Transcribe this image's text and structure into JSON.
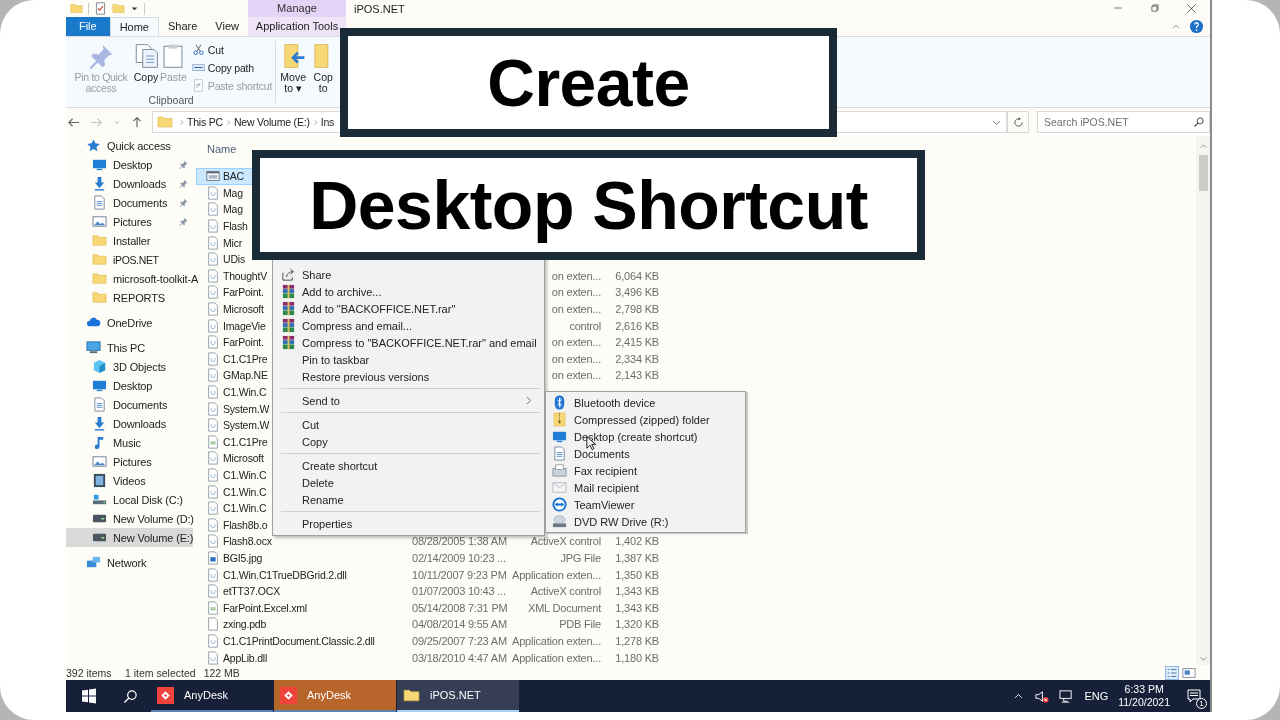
{
  "window": {
    "title": "iPOS.NET"
  },
  "ribbon": {
    "context_tab_group": "Manage",
    "tabs": [
      {
        "label": "File",
        "kind": "file",
        "selected": false
      },
      {
        "label": "Home",
        "kind": "normal",
        "selected": true
      },
      {
        "label": "Share",
        "kind": "normal",
        "selected": false
      },
      {
        "label": "View",
        "kind": "normal",
        "selected": false
      },
      {
        "label": "Application Tools",
        "kind": "context",
        "selected": false
      }
    ],
    "clipboard": {
      "label": "Clipboard",
      "large": [
        {
          "label": "Pin to Quick access",
          "kind": "pin",
          "disabled": true
        },
        {
          "label": "Copy",
          "kind": "copy",
          "disabled": false
        },
        {
          "label": "Paste",
          "kind": "paste",
          "disabled": true
        }
      ],
      "small": [
        {
          "label": "Cut",
          "kind": "cut",
          "disabled": false
        },
        {
          "label": "Copy path",
          "kind": "copypath",
          "disabled": false
        },
        {
          "label": "Paste shortcut",
          "kind": "pasteshortcut",
          "disabled": true
        }
      ]
    },
    "organize": [
      {
        "lines": [
          "Move",
          "to ▾"
        ],
        "kind": "move"
      },
      {
        "lines": [
          "Cop",
          "to"
        ],
        "kind": "copyto"
      }
    ]
  },
  "address": {
    "breadcrumbs": [
      "This PC",
      "New Volume (E:)",
      "Ins"
    ],
    "search_placeholder": "Search iPOS.NET"
  },
  "nav": {
    "items": [
      {
        "label": "Quick access",
        "kind": "star",
        "selected": false,
        "children": [
          {
            "label": "Desktop",
            "kind": "desktop",
            "pinned": true,
            "selected": false
          },
          {
            "label": "Downloads",
            "kind": "downloads",
            "pinned": true,
            "selected": false
          },
          {
            "label": "Documents",
            "kind": "documents",
            "pinned": true,
            "selected": false
          },
          {
            "label": "Pictures",
            "kind": "pictures",
            "pinned": true,
            "selected": false
          },
          {
            "label": "Installer",
            "kind": "folder",
            "pinned": false,
            "selected": false
          },
          {
            "label": "iPOS.NET",
            "kind": "folder",
            "pinned": false,
            "selected": false
          },
          {
            "label": "microsoft-toolkit-A",
            "kind": "folder",
            "pinned": false,
            "selected": false
          },
          {
            "label": "REPORTS",
            "kind": "folder",
            "pinned": false,
            "selected": false
          }
        ]
      },
      {
        "label": "OneDrive",
        "kind": "cloud",
        "selected": false
      },
      {
        "label": "This PC",
        "kind": "pc",
        "selected": false,
        "children": [
          {
            "label": "3D Objects",
            "kind": "cube",
            "selected": false
          },
          {
            "label": "Desktop",
            "kind": "desktop",
            "selected": false
          },
          {
            "label": "Documents",
            "kind": "documents",
            "selected": false
          },
          {
            "label": "Downloads",
            "kind": "downloads",
            "selected": false
          },
          {
            "label": "Music",
            "kind": "music",
            "selected": false
          },
          {
            "label": "Pictures",
            "kind": "pictures",
            "selected": false
          },
          {
            "label": "Videos",
            "kind": "video",
            "selected": false
          },
          {
            "label": "Local Disk (C:)",
            "kind": "sysdisk",
            "selected": false
          },
          {
            "label": "New Volume (D:)",
            "kind": "drive",
            "selected": false
          },
          {
            "label": "New Volume (E:)",
            "kind": "drive",
            "selected": true
          }
        ]
      },
      {
        "label": "Network",
        "kind": "network",
        "selected": false
      }
    ]
  },
  "files": {
    "name_header": "Name",
    "rows": [
      {
        "name": "BAC",
        "kind": "program",
        "selected": true
      },
      {
        "name": "Mag",
        "kind": "file",
        "selected": false
      },
      {
        "name": "Mag",
        "kind": "file",
        "selected": false
      },
      {
        "name": "Flash",
        "kind": "file",
        "selected": false
      },
      {
        "name": "Micr",
        "kind": "file",
        "selected": false
      },
      {
        "name": "UDis",
        "kind": "file",
        "selected": false
      },
      {
        "name": "ThoughtV",
        "kind": "file",
        "type": "on exten...",
        "size": "6,064 KB",
        "selected": false
      },
      {
        "name": "FarPoint.",
        "kind": "file",
        "type": "on exten...",
        "size": "3,496 KB",
        "selected": false
      },
      {
        "name": "Microsoft",
        "kind": "file",
        "type": "on exten...",
        "size": "2,798 KB",
        "selected": false
      },
      {
        "name": "ImageVie",
        "kind": "file",
        "type": "control",
        "size": "2,616 KB",
        "selected": false
      },
      {
        "name": "FarPoint.",
        "kind": "file",
        "type": "on exten...",
        "size": "2,415 KB",
        "selected": false
      },
      {
        "name": "C1.C1Pre",
        "kind": "file",
        "type": "on exten...",
        "size": "2,334 KB",
        "selected": false
      },
      {
        "name": "GMap.NE",
        "kind": "file",
        "type": "on exten...",
        "size": "2,143 KB",
        "selected": false
      },
      {
        "name": "C1.Win.C",
        "kind": "file",
        "selected": false
      },
      {
        "name": "System.W",
        "kind": "file",
        "selected": false
      },
      {
        "name": "System.W",
        "kind": "file",
        "selected": false
      },
      {
        "name": "C1.C1Pre",
        "kind": "xml",
        "selected": false
      },
      {
        "name": "Microsoft",
        "kind": "file",
        "selected": false
      },
      {
        "name": "C1.Win.C",
        "kind": "file",
        "selected": false
      },
      {
        "name": "C1.Win.C",
        "kind": "file",
        "selected": false
      },
      {
        "name": "C1.Win.C",
        "kind": "file",
        "selected": false
      },
      {
        "name": "Flash8b.o",
        "kind": "file",
        "selected": false
      },
      {
        "name": "Flash8.ocx",
        "kind": "file",
        "date": "08/28/2005 1:38 AM",
        "type": "ActiveX control",
        "size": "1,402 KB",
        "selected": false
      },
      {
        "name": "BGI5.jpg",
        "kind": "image",
        "date": "02/14/2009 10:23 ...",
        "type": "JPG File",
        "size": "1,387 KB",
        "selected": false
      },
      {
        "name": "C1.Win.C1TrueDBGrid.2.dll",
        "kind": "file",
        "date": "10/11/2007 9:23 PM",
        "type": "Application exten...",
        "size": "1,350 KB",
        "selected": false
      },
      {
        "name": "etTT37.OCX",
        "kind": "file",
        "date": "01/07/2003 10:43 ...",
        "type": "ActiveX control",
        "size": "1,343 KB",
        "selected": false
      },
      {
        "name": "FarPoint.Excel.xml",
        "kind": "xml",
        "date": "05/14/2008 7:31 PM",
        "type": "XML Document",
        "size": "1,343 KB",
        "selected": false
      },
      {
        "name": "zxing.pdb",
        "kind": "blank",
        "date": "04/08/2014 9:55 AM",
        "type": "PDB File",
        "size": "1,320 KB",
        "selected": false
      },
      {
        "name": "C1.C1PrintDocument.Classic.2.dll",
        "kind": "file",
        "date": "09/25/2007 7:23 AM",
        "type": "Application exten...",
        "size": "1,278 KB",
        "selected": false
      },
      {
        "name": "AppLib.dll",
        "kind": "file",
        "date": "03/18/2010 4:47 AM",
        "type": "Application exten...",
        "size": "1,180 KB",
        "selected": false
      }
    ]
  },
  "status_bar": {
    "count": "392 items",
    "selection": "1 item selected",
    "size": "122 MB"
  },
  "context_menu": {
    "groups": [
      [
        {
          "label": "Share",
          "kind": "share"
        },
        {
          "label": "Add to archive...",
          "kind": "archive"
        },
        {
          "label": "Add to \"BACKOFFICE.NET.rar\"",
          "kind": "archive"
        },
        {
          "label": "Compress and email...",
          "kind": "archive"
        },
        {
          "label": "Compress to \"BACKOFFICE.NET.rar\" and email",
          "kind": "archive"
        },
        {
          "label": "Pin to taskbar",
          "kind": "plain"
        },
        {
          "label": "Restore previous versions",
          "kind": "plain"
        }
      ],
      [
        {
          "label": "Send to",
          "kind": "submenu"
        }
      ],
      [
        {
          "label": "Cut",
          "kind": "plain"
        },
        {
          "label": "Copy",
          "kind": "plain"
        }
      ],
      [
        {
          "label": "Create shortcut",
          "kind": "plain"
        },
        {
          "label": "Delete",
          "kind": "plain"
        },
        {
          "label": "Rename",
          "kind": "plain"
        }
      ],
      [
        {
          "label": "Properties",
          "kind": "plain"
        }
      ]
    ]
  },
  "send_to_menu": {
    "items": [
      {
        "label": "Bluetooth device",
        "kind": "bluetooth"
      },
      {
        "label": "Compressed (zipped) folder",
        "kind": "zip"
      },
      {
        "label": "Desktop (create shortcut)",
        "kind": "desktop"
      },
      {
        "label": "Documents",
        "kind": "documents"
      },
      {
        "label": "Fax recipient",
        "kind": "fax"
      },
      {
        "label": "Mail recipient",
        "kind": "mail"
      },
      {
        "label": "TeamViewer",
        "kind": "teamviewer"
      },
      {
        "label": "DVD RW Drive (R:)",
        "kind": "dvd"
      }
    ]
  },
  "title_cards": [
    "Create",
    "Desktop Shortcut"
  ],
  "taskbar": {
    "apps": [
      {
        "label": "AnyDesk",
        "kind": "remote",
        "selected": false,
        "attention": false
      },
      {
        "label": "AnyDesk",
        "kind": "remote",
        "selected": false,
        "attention": true
      },
      {
        "label": "iPOS.NET",
        "kind": "folder",
        "selected": true,
        "attention": false
      }
    ],
    "language": "ENG",
    "time": "6:33 PM",
    "date": "11/20/2021",
    "notifications": "1"
  }
}
